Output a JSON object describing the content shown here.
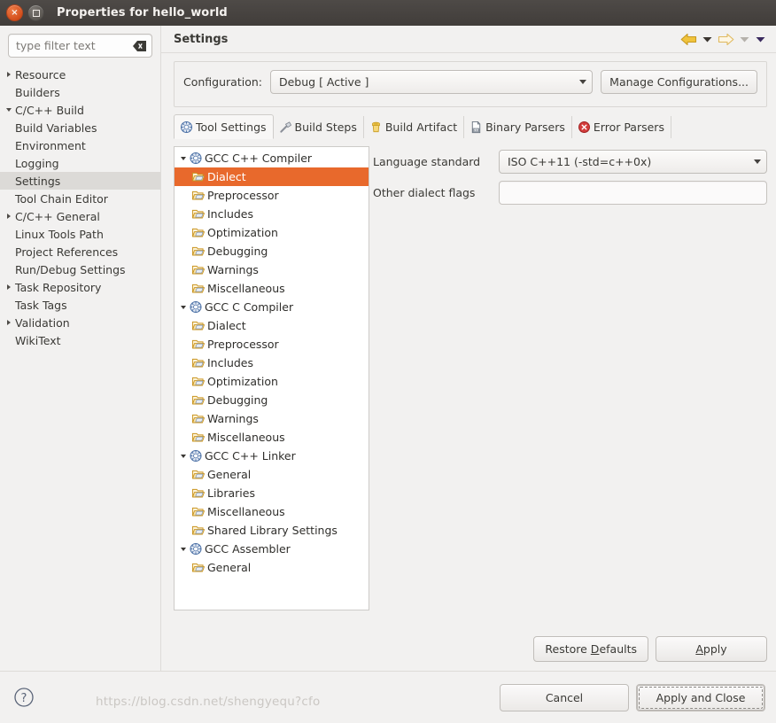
{
  "window": {
    "title": "Properties for hello_world",
    "close_icon": "close-icon",
    "maximize_icon": "maximize-icon"
  },
  "sidebar": {
    "filter": {
      "value": "",
      "placeholder": "type filter text",
      "clear_icon": "clear-icon"
    },
    "items": [
      {
        "label": "Resource",
        "twisty": "collapsed",
        "level": 0,
        "selected": false
      },
      {
        "label": "Builders",
        "twisty": "none",
        "level": 0,
        "selected": false
      },
      {
        "label": "C/C++ Build",
        "twisty": "expanded",
        "level": 0,
        "selected": false
      },
      {
        "label": "Build Variables",
        "twisty": "none",
        "level": 1,
        "selected": false
      },
      {
        "label": "Environment",
        "twisty": "none",
        "level": 1,
        "selected": false
      },
      {
        "label": "Logging",
        "twisty": "none",
        "level": 1,
        "selected": false
      },
      {
        "label": "Settings",
        "twisty": "none",
        "level": 1,
        "selected": true
      },
      {
        "label": "Tool Chain Editor",
        "twisty": "none",
        "level": 1,
        "selected": false
      },
      {
        "label": "C/C++ General",
        "twisty": "collapsed",
        "level": 0,
        "selected": false
      },
      {
        "label": "Linux Tools Path",
        "twisty": "none",
        "level": 0,
        "selected": false
      },
      {
        "label": "Project References",
        "twisty": "none",
        "level": 0,
        "selected": false
      },
      {
        "label": "Run/Debug Settings",
        "twisty": "none",
        "level": 0,
        "selected": false
      },
      {
        "label": "Task Repository",
        "twisty": "collapsed",
        "level": 0,
        "selected": false
      },
      {
        "label": "Task Tags",
        "twisty": "none",
        "level": 0,
        "selected": false
      },
      {
        "label": "Validation",
        "twisty": "collapsed",
        "level": 0,
        "selected": false
      },
      {
        "label": "WikiText",
        "twisty": "none",
        "level": 0,
        "selected": false
      }
    ]
  },
  "main": {
    "page_title": "Settings",
    "nav": {
      "back_icon": "back-arrow-icon",
      "back_menu_icon": "chevron-down-icon",
      "forward_icon": "forward-arrow-icon",
      "forward_menu_icon": "chevron-down-icon",
      "history_menu_icon": "chevron-down-icon"
    },
    "configuration": {
      "label": "Configuration:",
      "value": "Debug  [ Active ]",
      "dropdown_icon": "chevron-down-icon",
      "manage_label": "Manage Configurations..."
    },
    "tabs": [
      {
        "label": "Tool Settings",
        "icon": "gear-icon",
        "active": true
      },
      {
        "label": "Build Steps",
        "icon": "hammer-icon",
        "active": false
      },
      {
        "label": "Build Artifact",
        "icon": "artifact-icon",
        "active": false
      },
      {
        "label": "Binary Parsers",
        "icon": "binary-file-icon",
        "active": false
      },
      {
        "label": "Error Parsers",
        "icon": "error-icon",
        "active": false
      }
    ],
    "tool_tree": [
      {
        "label": "GCC C++ Compiler",
        "icon": "gear-icon",
        "twisty": "expanded",
        "child": false,
        "selected": false
      },
      {
        "label": "Dialect",
        "icon": "folder-icon",
        "twisty": "none",
        "child": true,
        "selected": true
      },
      {
        "label": "Preprocessor",
        "icon": "folder-icon",
        "twisty": "none",
        "child": true,
        "selected": false
      },
      {
        "label": "Includes",
        "icon": "folder-icon",
        "twisty": "none",
        "child": true,
        "selected": false
      },
      {
        "label": "Optimization",
        "icon": "folder-icon",
        "twisty": "none",
        "child": true,
        "selected": false
      },
      {
        "label": "Debugging",
        "icon": "folder-icon",
        "twisty": "none",
        "child": true,
        "selected": false
      },
      {
        "label": "Warnings",
        "icon": "folder-icon",
        "twisty": "none",
        "child": true,
        "selected": false
      },
      {
        "label": "Miscellaneous",
        "icon": "folder-icon",
        "twisty": "none",
        "child": true,
        "selected": false
      },
      {
        "label": "GCC C Compiler",
        "icon": "gear-icon",
        "twisty": "expanded",
        "child": false,
        "selected": false
      },
      {
        "label": "Dialect",
        "icon": "folder-icon",
        "twisty": "none",
        "child": true,
        "selected": false
      },
      {
        "label": "Preprocessor",
        "icon": "folder-icon",
        "twisty": "none",
        "child": true,
        "selected": false
      },
      {
        "label": "Includes",
        "icon": "folder-icon",
        "twisty": "none",
        "child": true,
        "selected": false
      },
      {
        "label": "Optimization",
        "icon": "folder-icon",
        "twisty": "none",
        "child": true,
        "selected": false
      },
      {
        "label": "Debugging",
        "icon": "folder-icon",
        "twisty": "none",
        "child": true,
        "selected": false
      },
      {
        "label": "Warnings",
        "icon": "folder-icon",
        "twisty": "none",
        "child": true,
        "selected": false
      },
      {
        "label": "Miscellaneous",
        "icon": "folder-icon",
        "twisty": "none",
        "child": true,
        "selected": false
      },
      {
        "label": "GCC C++ Linker",
        "icon": "gear-icon",
        "twisty": "expanded",
        "child": false,
        "selected": false
      },
      {
        "label": "General",
        "icon": "folder-icon",
        "twisty": "none",
        "child": true,
        "selected": false
      },
      {
        "label": "Libraries",
        "icon": "folder-icon",
        "twisty": "none",
        "child": true,
        "selected": false
      },
      {
        "label": "Miscellaneous",
        "icon": "folder-icon",
        "twisty": "none",
        "child": true,
        "selected": false
      },
      {
        "label": "Shared Library Settings",
        "icon": "folder-icon",
        "twisty": "none",
        "child": true,
        "selected": false
      },
      {
        "label": "GCC Assembler",
        "icon": "gear-icon",
        "twisty": "expanded",
        "child": false,
        "selected": false
      },
      {
        "label": "General",
        "icon": "folder-icon",
        "twisty": "none",
        "child": true,
        "selected": false
      }
    ],
    "form": {
      "language_standard": {
        "label": "Language standard",
        "value": "ISO C++11 (-std=c++0x)",
        "dropdown_icon": "chevron-down-icon"
      },
      "other_dialect_flags": {
        "label": "Other dialect flags",
        "value": ""
      }
    },
    "actions": {
      "restore_defaults": "Restore Defaults",
      "restore_defaults_mnemonic": "D",
      "apply": "Apply",
      "apply_mnemonic": "A"
    }
  },
  "footer": {
    "help_icon": "help-icon",
    "cancel": "Cancel",
    "apply_and_close": "Apply and Close"
  },
  "watermark": "https://blog.csdn.net/shengyequ?cfo",
  "colors": {
    "selection_orange": "#e8692c",
    "sidebar_selection": "#dcdad7",
    "window_chrome": "#413d3a",
    "panel_bg": "#f2f1f0",
    "tree_bg": "#ffffff"
  }
}
